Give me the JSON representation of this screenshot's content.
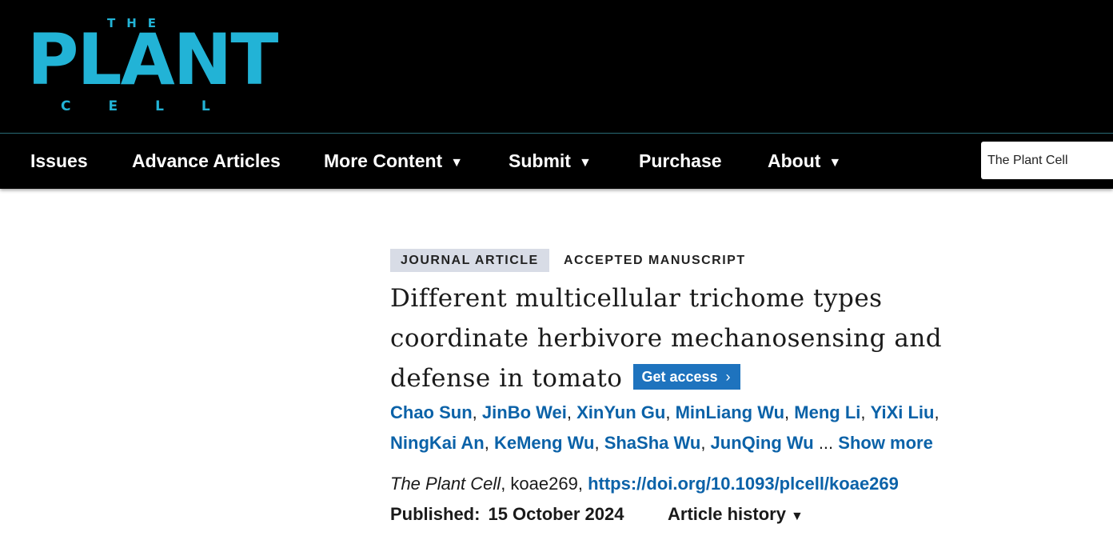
{
  "logo": {
    "the": "THE",
    "plant": "PLANT",
    "cell": "CELL"
  },
  "colors": {
    "brand": "#22b3d6",
    "link": "#0b62a8",
    "button": "#1e73be",
    "tag_bg": "#d8dce6",
    "header_bg": "#000000"
  },
  "nav": {
    "items": [
      {
        "label": "Issues"
      },
      {
        "label": "Advance Articles"
      },
      {
        "label": "More Content",
        "caret": "▼"
      },
      {
        "label": "Submit",
        "caret": "▼"
      },
      {
        "label": "Purchase"
      },
      {
        "label": "About",
        "caret": "▼"
      }
    ],
    "search_scope": "The Plant Cell"
  },
  "article": {
    "type_tag": "JOURNAL ARTICLE",
    "status_tag": "ACCEPTED MANUSCRIPT",
    "title": "Different multicellular trichome types coordinate herbivore mechanosensing and defense in tomato",
    "get_access": "Get access",
    "get_access_icon": "chevron-right-icon",
    "authors": [
      "Chao Sun",
      "JinBo Wei",
      "XinYun Gu",
      "MinLiang Wu",
      "Meng Li",
      "YiXi Liu",
      "NingKai An",
      "KeMeng Wu",
      "ShaSha Wu",
      "JunQing Wu"
    ],
    "ellipsis": "...",
    "show_more": "Show more",
    "journal": "The Plant Cell",
    "article_id": "koae269",
    "doi": "https://doi.org/10.1093/plcell/koae269",
    "published_label": "Published:",
    "published_date": "15 October 2024",
    "history_label": "Article history",
    "history_caret": "▼"
  }
}
